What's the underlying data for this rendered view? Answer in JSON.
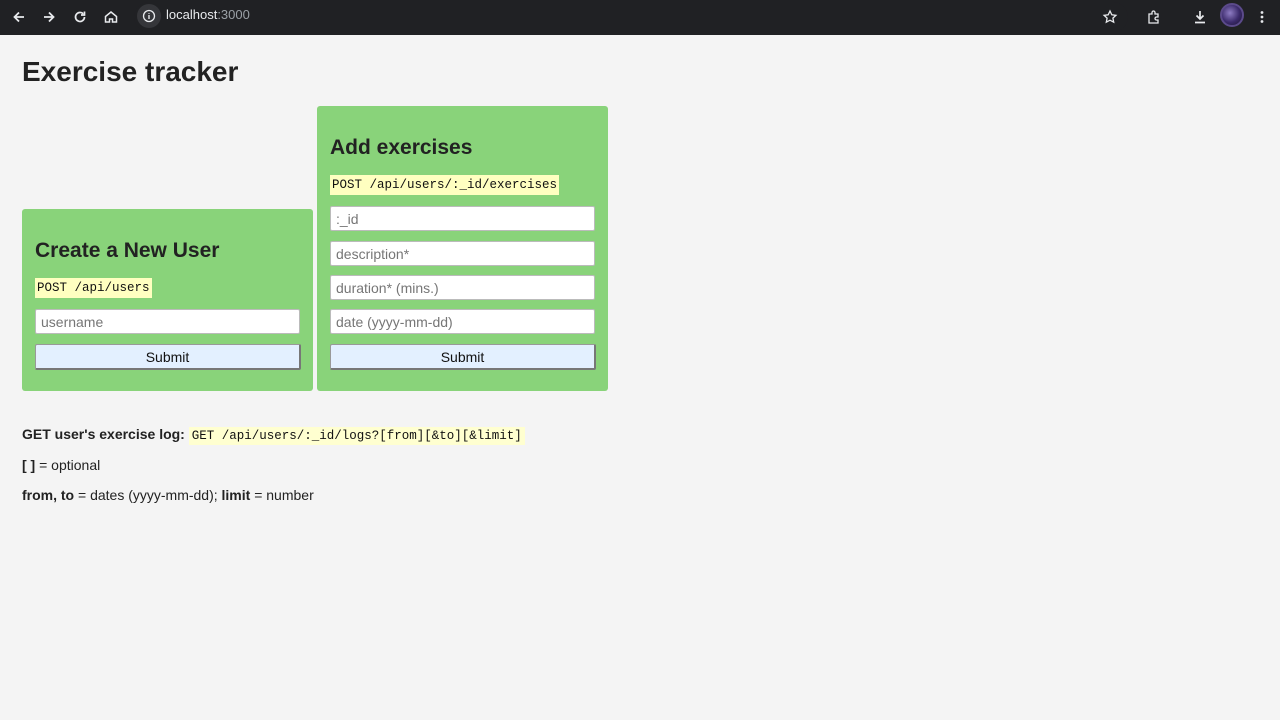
{
  "browser": {
    "url_host": "localhost",
    "url_port": ":3000",
    "icons": [
      "back-icon",
      "forward-icon",
      "reload-icon",
      "home-icon",
      "site-info-icon",
      "bookmark-star-icon",
      "extensions-icon",
      "download-icon",
      "profile-avatar",
      "menu-kebab-icon"
    ]
  },
  "page": {
    "title": "Exercise tracker"
  },
  "create_user": {
    "title": "Create a New User",
    "endpoint": "POST /api/users",
    "username_placeholder": "username",
    "username_value": "",
    "submit_label": "Submit"
  },
  "add_exercises": {
    "title": "Add exercises",
    "endpoint": "POST /api/users/:_id/exercises",
    "id_placeholder": ":_id",
    "description_placeholder": "description*",
    "duration_placeholder": "duration* (mins.)",
    "date_placeholder": "date (yyyy-mm-dd)",
    "submit_label": "Submit"
  },
  "info": {
    "log_label": "GET user's exercise log:",
    "log_endpoint": "GET /api/users/:_id/logs?[from][&to][&limit]",
    "optional_key": "[ ]",
    "optional_text": " = optional",
    "from_to_key": "from, to",
    "from_to_text": " = dates (yyyy-mm-dd); ",
    "limit_key": "limit",
    "limit_text": " = number"
  },
  "colors": {
    "card_bg": "#89d37a",
    "endpoint_bg": "#ffffc0",
    "button_bg": "#e3f0ff",
    "browser_bar": "#202124"
  }
}
